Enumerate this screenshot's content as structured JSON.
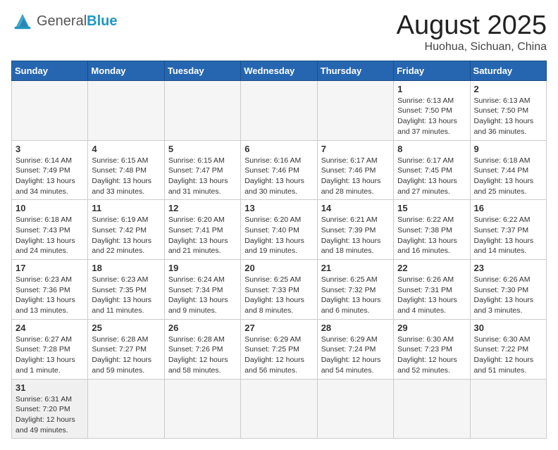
{
  "header": {
    "logo_general": "General",
    "logo_blue": "Blue",
    "month_title": "August 2025",
    "location": "Huohua, Sichuan, China"
  },
  "weekdays": [
    "Sunday",
    "Monday",
    "Tuesday",
    "Wednesday",
    "Thursday",
    "Friday",
    "Saturday"
  ],
  "weeks": [
    [
      {
        "day": "",
        "info": ""
      },
      {
        "day": "",
        "info": ""
      },
      {
        "day": "",
        "info": ""
      },
      {
        "day": "",
        "info": ""
      },
      {
        "day": "",
        "info": ""
      },
      {
        "day": "1",
        "info": "Sunrise: 6:13 AM\nSunset: 7:50 PM\nDaylight: 13 hours and 37 minutes."
      },
      {
        "day": "2",
        "info": "Sunrise: 6:13 AM\nSunset: 7:50 PM\nDaylight: 13 hours and 36 minutes."
      }
    ],
    [
      {
        "day": "3",
        "info": "Sunrise: 6:14 AM\nSunset: 7:49 PM\nDaylight: 13 hours and 34 minutes."
      },
      {
        "day": "4",
        "info": "Sunrise: 6:15 AM\nSunset: 7:48 PM\nDaylight: 13 hours and 33 minutes."
      },
      {
        "day": "5",
        "info": "Sunrise: 6:15 AM\nSunset: 7:47 PM\nDaylight: 13 hours and 31 minutes."
      },
      {
        "day": "6",
        "info": "Sunrise: 6:16 AM\nSunset: 7:46 PM\nDaylight: 13 hours and 30 minutes."
      },
      {
        "day": "7",
        "info": "Sunrise: 6:17 AM\nSunset: 7:46 PM\nDaylight: 13 hours and 28 minutes."
      },
      {
        "day": "8",
        "info": "Sunrise: 6:17 AM\nSunset: 7:45 PM\nDaylight: 13 hours and 27 minutes."
      },
      {
        "day": "9",
        "info": "Sunrise: 6:18 AM\nSunset: 7:44 PM\nDaylight: 13 hours and 25 minutes."
      }
    ],
    [
      {
        "day": "10",
        "info": "Sunrise: 6:18 AM\nSunset: 7:43 PM\nDaylight: 13 hours and 24 minutes."
      },
      {
        "day": "11",
        "info": "Sunrise: 6:19 AM\nSunset: 7:42 PM\nDaylight: 13 hours and 22 minutes."
      },
      {
        "day": "12",
        "info": "Sunrise: 6:20 AM\nSunset: 7:41 PM\nDaylight: 13 hours and 21 minutes."
      },
      {
        "day": "13",
        "info": "Sunrise: 6:20 AM\nSunset: 7:40 PM\nDaylight: 13 hours and 19 minutes."
      },
      {
        "day": "14",
        "info": "Sunrise: 6:21 AM\nSunset: 7:39 PM\nDaylight: 13 hours and 18 minutes."
      },
      {
        "day": "15",
        "info": "Sunrise: 6:22 AM\nSunset: 7:38 PM\nDaylight: 13 hours and 16 minutes."
      },
      {
        "day": "16",
        "info": "Sunrise: 6:22 AM\nSunset: 7:37 PM\nDaylight: 13 hours and 14 minutes."
      }
    ],
    [
      {
        "day": "17",
        "info": "Sunrise: 6:23 AM\nSunset: 7:36 PM\nDaylight: 13 hours and 13 minutes."
      },
      {
        "day": "18",
        "info": "Sunrise: 6:23 AM\nSunset: 7:35 PM\nDaylight: 13 hours and 11 minutes."
      },
      {
        "day": "19",
        "info": "Sunrise: 6:24 AM\nSunset: 7:34 PM\nDaylight: 13 hours and 9 minutes."
      },
      {
        "day": "20",
        "info": "Sunrise: 6:25 AM\nSunset: 7:33 PM\nDaylight: 13 hours and 8 minutes."
      },
      {
        "day": "21",
        "info": "Sunrise: 6:25 AM\nSunset: 7:32 PM\nDaylight: 13 hours and 6 minutes."
      },
      {
        "day": "22",
        "info": "Sunrise: 6:26 AM\nSunset: 7:31 PM\nDaylight: 13 hours and 4 minutes."
      },
      {
        "day": "23",
        "info": "Sunrise: 6:26 AM\nSunset: 7:30 PM\nDaylight: 13 hours and 3 minutes."
      }
    ],
    [
      {
        "day": "24",
        "info": "Sunrise: 6:27 AM\nSunset: 7:28 PM\nDaylight: 13 hours and 1 minute."
      },
      {
        "day": "25",
        "info": "Sunrise: 6:28 AM\nSunset: 7:27 PM\nDaylight: 12 hours and 59 minutes."
      },
      {
        "day": "26",
        "info": "Sunrise: 6:28 AM\nSunset: 7:26 PM\nDaylight: 12 hours and 58 minutes."
      },
      {
        "day": "27",
        "info": "Sunrise: 6:29 AM\nSunset: 7:25 PM\nDaylight: 12 hours and 56 minutes."
      },
      {
        "day": "28",
        "info": "Sunrise: 6:29 AM\nSunset: 7:24 PM\nDaylight: 12 hours and 54 minutes."
      },
      {
        "day": "29",
        "info": "Sunrise: 6:30 AM\nSunset: 7:23 PM\nDaylight: 12 hours and 52 minutes."
      },
      {
        "day": "30",
        "info": "Sunrise: 6:30 AM\nSunset: 7:22 PM\nDaylight: 12 hours and 51 minutes."
      }
    ],
    [
      {
        "day": "31",
        "info": "Sunrise: 6:31 AM\nSunset: 7:20 PM\nDaylight: 12 hours and 49 minutes."
      },
      {
        "day": "",
        "info": ""
      },
      {
        "day": "",
        "info": ""
      },
      {
        "day": "",
        "info": ""
      },
      {
        "day": "",
        "info": ""
      },
      {
        "day": "",
        "info": ""
      },
      {
        "day": "",
        "info": ""
      }
    ]
  ]
}
